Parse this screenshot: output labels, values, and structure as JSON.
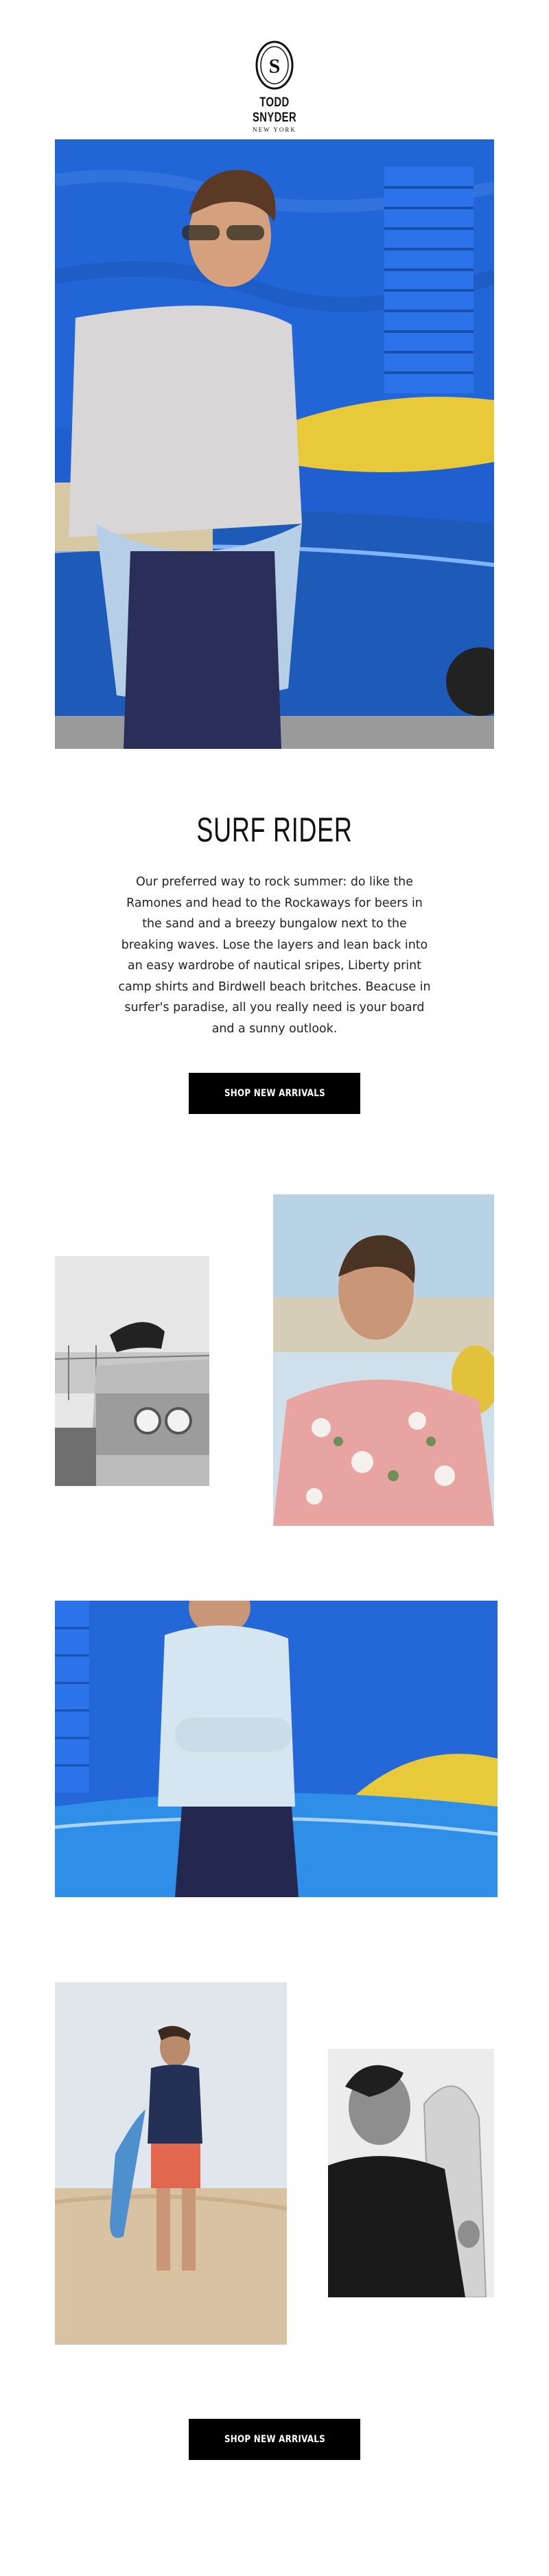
{
  "brand": {
    "wordmark": "TODD SNYDER",
    "location": "NEW YORK",
    "seal_initials": "S"
  },
  "hero": {
    "image_alt": "Man in sunglasses leaning on a blue convertible with a yellow surfboard"
  },
  "headline": "SURF RIDER",
  "body_text": "Our preferred way to rock summer: do like the Ramones and head to the Rockaways for beers in the sand and a breezy bungalow next to the breaking waves. Lose the layers and lean back into an easy wardrobe of nautical sripes, Liberty print camp shirts and Birdwell beach britches. Beacuse in surfer's paradise, all you really need is your board and a sunny outlook.",
  "cta_top": {
    "label": "SHOP NEW ARRIVALS"
  },
  "cta_bottom": {
    "label": "SHOP NEW ARRIVALS"
  },
  "colors": {
    "wall_blue": "#1f5fcf",
    "car_blue": "#1e5ab8",
    "surfboard_yellow": "#e8c93a",
    "button_black": "#000000"
  }
}
